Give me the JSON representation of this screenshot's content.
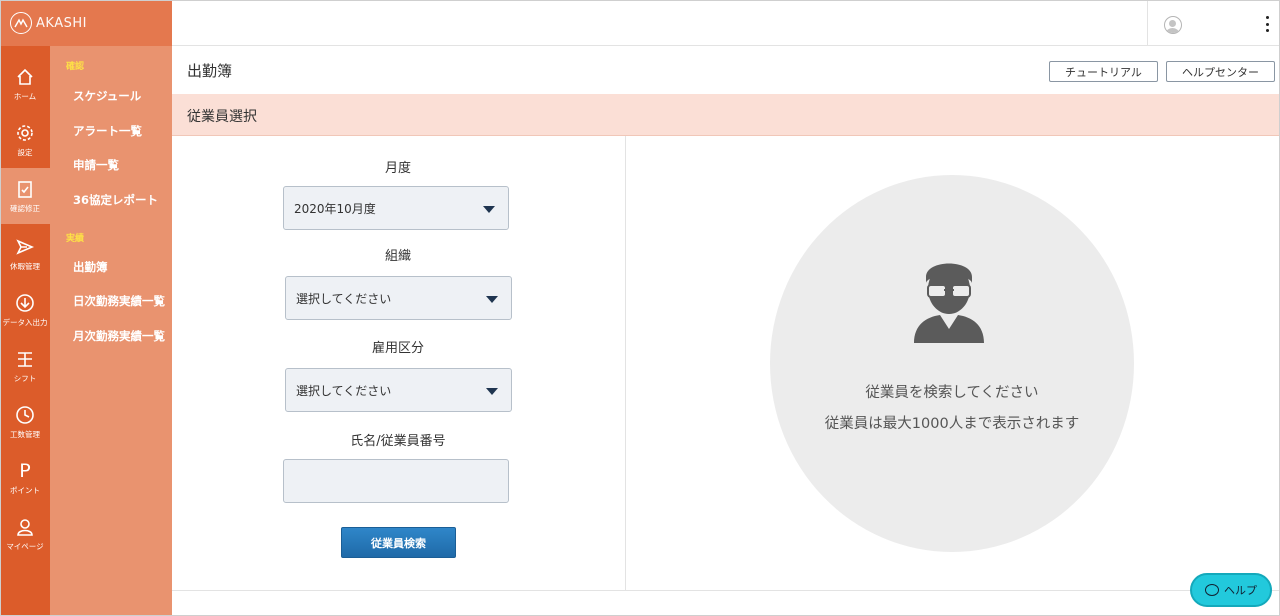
{
  "brand": {
    "name": "AKASHI"
  },
  "rail": [
    {
      "label": "ホーム",
      "icon": "home-icon"
    },
    {
      "label": "設定",
      "icon": "gear-icon"
    },
    {
      "label": "確認修正",
      "icon": "clipboard-check-icon"
    },
    {
      "label": "休暇管理",
      "icon": "plane-icon"
    },
    {
      "label": "データ入出力",
      "icon": "download-icon"
    },
    {
      "label": "シフト",
      "icon": "shift-icon"
    },
    {
      "label": "工数管理",
      "icon": "clock-icon"
    },
    {
      "label": "ポイント",
      "icon": "p-icon",
      "glyph": "P"
    },
    {
      "label": "マイページ",
      "icon": "person-icon"
    }
  ],
  "subnav": {
    "section_confirm": "確認",
    "section_results": "実績",
    "items": [
      "スケジュール",
      "アラート一覧",
      "申請一覧",
      "36協定レポート",
      "出勤簿",
      "日次勤務実績一覧",
      "月次勤務実績一覧"
    ]
  },
  "header": {
    "title": "出勤簿",
    "tutorial_label": "チュートリアル",
    "help_center_label": "ヘルプセンター"
  },
  "section": {
    "title": "従業員選択"
  },
  "form": {
    "month_label": "月度",
    "month_value": "2020年10月度",
    "org_label": "組織",
    "org_value": "選択してください",
    "employment_label": "雇用区分",
    "employment_value": "選択してください",
    "name_label": "氏名/従業員番号",
    "name_value": "",
    "search_button": "従業員検索"
  },
  "empty_state": {
    "line1": "従業員を検索してください",
    "line2": "従業員は最大1000人まで表示されます"
  },
  "help": {
    "label": "ヘルプ"
  },
  "colors": {
    "rail": "#dc5c2a",
    "subnav": "#e9936f",
    "section": "#fbdfd6",
    "primary": "#1f6aa8",
    "help": "#22c9dc"
  }
}
